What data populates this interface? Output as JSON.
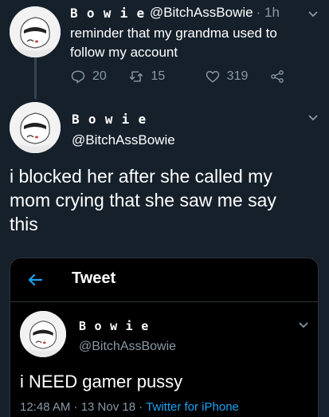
{
  "reply_tweet": {
    "display_name": "B o w i e",
    "handle": "@BitchAssBowie",
    "time": "· 1h",
    "text_line1": "reminder that my grandma used to",
    "text_line2": "follow my account",
    "replies": "20",
    "retweets": "15",
    "likes": "319"
  },
  "main_tweet": {
    "display_name": "B o w i e",
    "handle": "@BitchAssBowie",
    "text_line1": "i blocked her after she called my",
    "text_line2": "mom crying that she saw me say",
    "text_line3": "this"
  },
  "quoted_screenshot": {
    "header_title": "Tweet",
    "display_name": "B o w i e",
    "handle": "@BitchAssBowie",
    "text": "i NEED gamer pussy",
    "timestamp": "12:48 AM · 13 Nov 18 · ",
    "source": "Twitter for iPhone"
  },
  "colors": {
    "background": "#15202b",
    "card_background": "#000000",
    "muted_text": "#8899a6",
    "accent": "#1da1f2"
  }
}
